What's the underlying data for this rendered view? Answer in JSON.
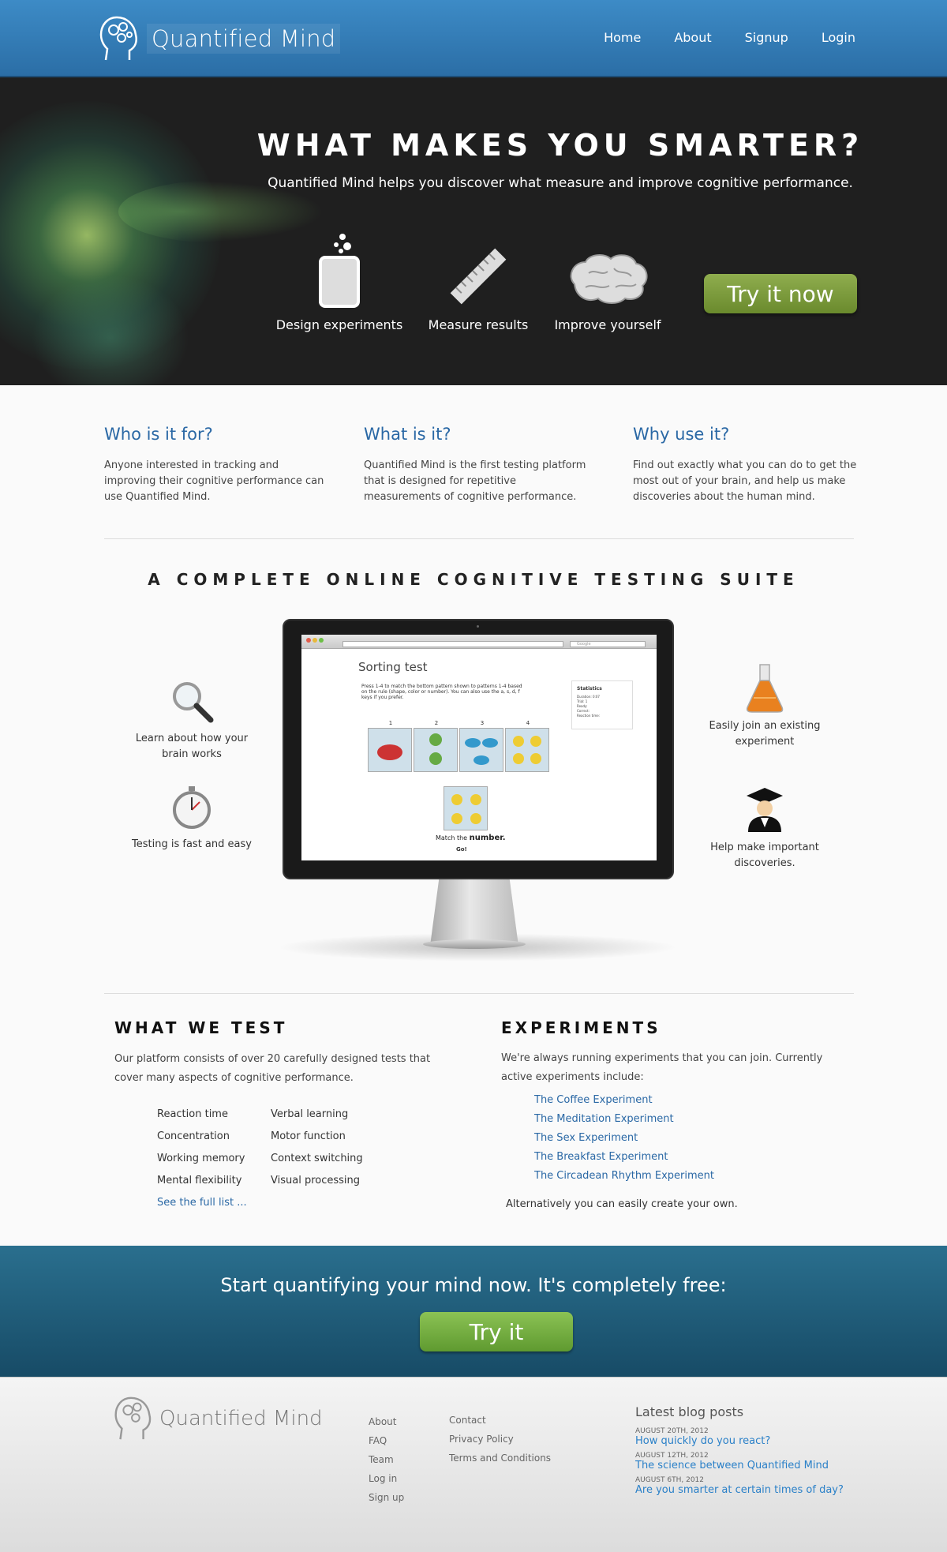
{
  "header": {
    "logo_text": "Quantified Mind",
    "nav": [
      "Home",
      "About",
      "Signup",
      "Login"
    ]
  },
  "hero": {
    "title": "WHAT MAKES YOU SMARTER?",
    "subtitle": "Quantified Mind helps you discover what measure and improve cognitive performance.",
    "features": [
      "Design experiments",
      "Measure results",
      "Improve yourself"
    ],
    "cta": "Try it now"
  },
  "intro": [
    {
      "title": "Who is it for?",
      "text": "Anyone interested in tracking and improving their cognitive performance can use Quantified Mind."
    },
    {
      "title": "What is it?",
      "text": "Quantified Mind is the first testing platform that is designed for repetitive measurements of cognitive performance."
    },
    {
      "title": "Why use it?",
      "text": "Find out exactly what you can do to get the most out of your brain, and help us make discoveries about the human mind."
    }
  ],
  "suite": {
    "title": "A COMPLETE ONLINE COGNITIVE TESTING SUITE",
    "left": [
      "Learn about how your brain works",
      "Testing is fast and easy"
    ],
    "right": [
      "Easily join an existing experiment",
      "Help make important discoveries."
    ],
    "screen": {
      "title": "Sorting test",
      "instructions": "Press 1-4 to match the bottom pattern shown to patterns 1-4 based on the rule (shape, color or number). You can also use the a, s, d, f keys if you prefer.",
      "stats_title": "Statistics",
      "stats_lines": [
        "Duration: 0:07",
        "Trial: 1",
        "Ready:",
        "Correct:",
        "Reaction time:"
      ],
      "tile_numbers": [
        "1",
        "2",
        "3",
        "4"
      ],
      "match_prefix": "Match the",
      "match_word": "number.",
      "go": "Go!",
      "search_placeholder": "Google"
    }
  },
  "what_we_test": {
    "title": "WHAT WE TEST",
    "text": "Our platform consists of over 20 carefully designed tests that cover many aspects of cognitive performance.",
    "col1": [
      "Reaction time",
      "Concentration",
      "Working memory",
      "Mental flexibility"
    ],
    "col2": [
      "Verbal learning",
      "Motor function",
      "Context switching",
      "Visual processing"
    ],
    "full_list": "See the full list ..."
  },
  "experiments": {
    "title": "EXPERIMENTS",
    "text": "We're always running experiments that you can join. Currently active experiments include:",
    "items": [
      "The Coffee Experiment",
      "The Meditation Experiment",
      "The Sex Experiment",
      "The Breakfast Experiment",
      "The Circadean Rhythm Experiment"
    ],
    "alt": "Alternatively you can easily create your own."
  },
  "cta": {
    "text": "Start quantifying your mind now. It's completely free:",
    "button": "Try it"
  },
  "footer": {
    "logo_text": "Quantified Mind",
    "links1": [
      "About",
      "FAQ",
      "Team",
      "Log in",
      "Sign up"
    ],
    "links2": [
      "Contact",
      "Privacy Policy",
      "Terms and Conditions"
    ],
    "blog_title": "Latest blog posts",
    "posts": [
      {
        "date": "AUGUST 20TH, 2012",
        "title": "How quickly do you react?"
      },
      {
        "date": "AUGUST 12TH, 2012",
        "title": "The science between Quantified Mind"
      },
      {
        "date": "AUGUST 6TH, 2012",
        "title": "Are you smarter at certain times of day?"
      }
    ]
  },
  "colors": {
    "brand_blue": "#2b6ea6",
    "accent_green": "#7a9a3c",
    "link": "#2a68a5"
  }
}
